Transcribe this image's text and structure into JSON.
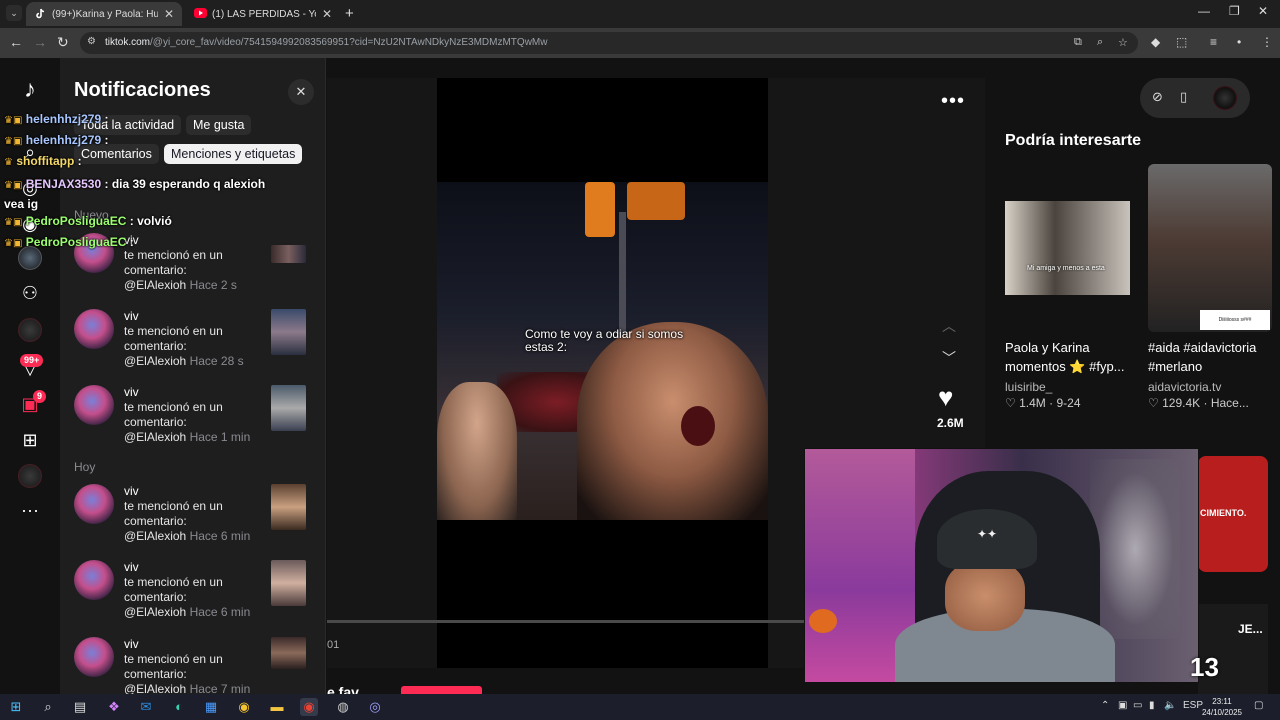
{
  "browser": {
    "tabs": [
      {
        "title": "(99+)Karina y Paola: Humor y P",
        "active": true,
        "icon": "tiktok-icon"
      },
      {
        "title": "(1) LAS PERDIDAS - YouTube",
        "active": false,
        "icon": "youtube-icon"
      }
    ],
    "url_host": "tiktok.com",
    "url_path": "/@yi_core_fav/video/7541594992083569951?cid=NzU2NTAwNDkyNzE3MDMzMTQwMw"
  },
  "sidebar": {
    "badges": {
      "inbox": "99+",
      "messages": "9"
    }
  },
  "notifications": {
    "title": "Notificaciones",
    "filters": [
      "Toda la actividad",
      "Me gusta",
      "Comentarios",
      "Menciones y etiquetas"
    ],
    "selected_filter": "Menciones y etiquetas",
    "sections": {
      "new": "Nuevo",
      "today": "Hoy"
    },
    "items": [
      {
        "name": "viv",
        "text": "te mencionó en un comentario:",
        "mention": "@ElAlexioh",
        "time": "Hace 2 s"
      },
      {
        "name": "viv",
        "text": "te mencionó en un comentario:",
        "mention": "@ElAlexioh",
        "time": "Hace 28 s"
      },
      {
        "name": "viv",
        "text": "te mencionó en un comentario:",
        "mention": "@ElAlexioh",
        "time": "Hace 1 min"
      },
      {
        "name": "viv",
        "text": "te mencionó en un comentario:",
        "mention": "@ElAlexioh",
        "time": "Hace 6 min"
      },
      {
        "name": "viv",
        "text": "te mencionó en un comentario:",
        "mention": "@ElAlexioh",
        "time": "Hace 6 min"
      },
      {
        "name": "viv",
        "text": "te mencionó en un comentario:",
        "mention": "@ElAlexioh",
        "time": "Hace 7 min"
      }
    ]
  },
  "chat": [
    {
      "user": "helenhhzj279",
      "msg": ":"
    },
    {
      "user": "helenhhzj279",
      "msg": ":"
    },
    {
      "user": "shoffitapp",
      "msg": ":"
    },
    {
      "user": "BENJAX3530",
      "msg": ": dia 39 esperando q alexioh vea ig"
    },
    {
      "user": "PedroPosliguaEC",
      "msg": ": volvió"
    },
    {
      "user": "PedroPosliguaEC",
      "msg": ":"
    }
  ],
  "video": {
    "caption": "Como te voy a odiar si somos estas 2:",
    "likes": "2.6M",
    "timecode": "01",
    "uploader_fragment": "e fav"
  },
  "recommendations": {
    "title": "Podría interesarte",
    "cards": [
      {
        "desc": "Paola y Karina momentos ⭐ #fyp...",
        "user": "luisiribe_",
        "likes": "1.4M",
        "date": "9-24",
        "thumb_text": "Mi amiga y menos a esta"
      },
      {
        "desc": "#aida #aidavictoria #merlano",
        "user": "aidavictoria.tv",
        "likes": "129.4K",
        "date": "Hace...",
        "thumb_text": "Diiiiiiosss s###"
      },
      {
        "thumb_text": "CIMIENTO."
      },
      {
        "thumb_text": "JE..."
      }
    ]
  },
  "stream_overlay": {
    "counter": "13"
  },
  "taskbar": {
    "language": "ESP",
    "time": "23:11",
    "date": "24/10/2025"
  },
  "colors": {
    "accent": "#fe2c55",
    "panel": "#1e1e1e",
    "background": "#121212"
  }
}
